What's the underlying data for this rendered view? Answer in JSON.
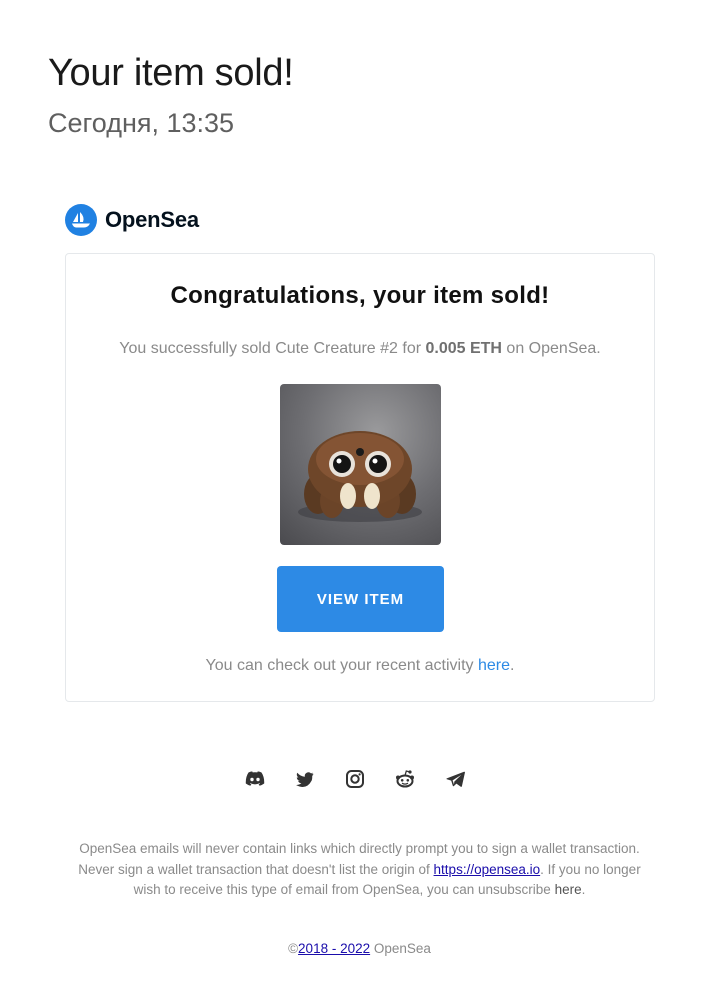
{
  "email": {
    "subject": "Your item sold!",
    "date": "Сегодня, 13:35"
  },
  "brand": {
    "name": "OpenSea",
    "color": "#2081e2"
  },
  "card": {
    "title": "Congratulations, your item sold!",
    "sale_prefix": "You successfully sold Cute Creature #2 for ",
    "price": "0.005 ETH",
    "sale_suffix": " on OpenSea.",
    "image_alt": "Cute Creature #2",
    "button_label": "VIEW ITEM",
    "activity_prefix": "You can check out your recent activity ",
    "activity_link": "here",
    "activity_suffix": "."
  },
  "socials": [
    {
      "icon": "discord-icon"
    },
    {
      "icon": "twitter-icon"
    },
    {
      "icon": "instagram-icon"
    },
    {
      "icon": "reddit-icon"
    },
    {
      "icon": "telegram-icon"
    }
  ],
  "footer": {
    "line1": "OpenSea emails will never contain links which directly prompt you to sign a wallet transaction.",
    "line2_prefix": "Never sign a wallet transaction that doesn't list the origin of ",
    "line2_link": "https://opensea.io",
    "line2_suffix": ". If you no longer",
    "line3_prefix": "wish to receive this type of email from OpenSea, you can unsubscribe ",
    "line3_link": "here",
    "line3_suffix": "."
  },
  "copyright": {
    "symbol": "©",
    "years": "2018 - 2022",
    "owner": " OpenSea"
  }
}
